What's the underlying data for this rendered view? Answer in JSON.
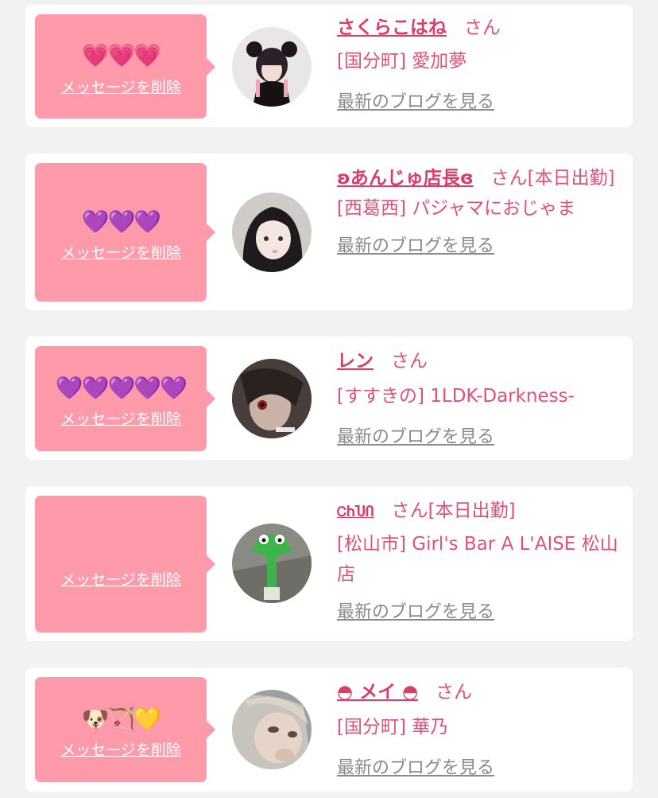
{
  "common": {
    "delete_label": "メッセージを削除",
    "san": "さん",
    "blog_link": "最新のブログを見る"
  },
  "colors": {
    "background": "#f2f2f2",
    "message_box": "#ff9aaa",
    "name": "#d83e6b",
    "text": "#e0517a",
    "link": "#8a8a8a"
  },
  "messages": [
    {
      "stamp": "💗💗💗",
      "name": "さくらこはね",
      "suffix": "",
      "shop": "[国分町] 愛加夢"
    },
    {
      "stamp": "💜💜💜",
      "name": "ʚあんじゅ店長ɞ",
      "suffix": "[本日出勤]",
      "shop": "[西葛西] パジャマにおじゃま"
    },
    {
      "stamp": "💜💜💜💜💜",
      "name": "レン",
      "suffix": "",
      "shop": "[すすきの] 1LDK-Darkness-"
    },
    {
      "stamp": "",
      "name": "ᏟႹႮႶ",
      "suffix": "[本日出勤]",
      "shop": "[松山市] Girl's Bar A L'AISE 松山店"
    },
    {
      "stamp": "🐶🏹💛",
      "name": "◓ メイ ◓",
      "suffix": "",
      "shop": "[国分町] 華乃"
    }
  ]
}
